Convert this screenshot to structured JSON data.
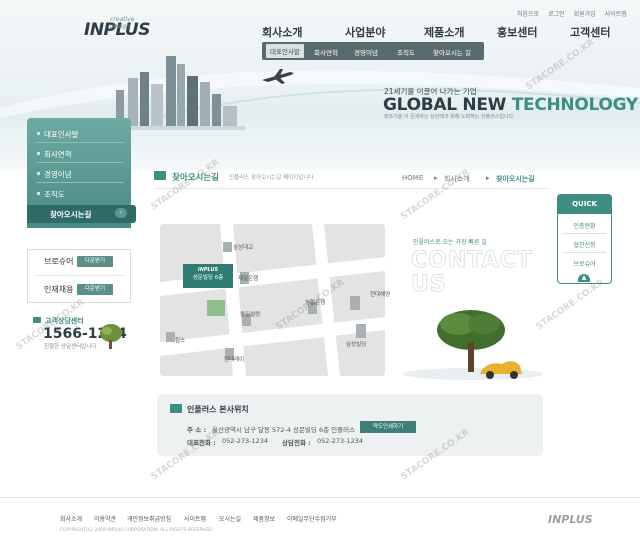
{
  "brand": {
    "logo": "INPLUS",
    "logo_tag": "creative design"
  },
  "util_links": [
    "처음으로",
    "로그인",
    "회원가입",
    "사이트맵"
  ],
  "gnb": [
    "회사소개",
    "사업분야",
    "제품소개",
    "홍보센터",
    "고객센터"
  ],
  "sub_nav": [
    "대표인사말",
    "회사연혁",
    "경영이념",
    "조직도",
    "찾아오시는 길"
  ],
  "slogan": {
    "ko": "21세기를 이끌어 나가는 기업",
    "en_a": "GLOBAL NEW ",
    "en_b": "TECHNOLOGY",
    "small": "창조기술 이 존재하는 상인테크 위해 노력하는 인플러스입니다."
  },
  "lnb": {
    "items": [
      "대표인사말",
      "회사연혁",
      "경영이념",
      "조직도"
    ],
    "active": "찾아오시는길"
  },
  "side_links": [
    {
      "label": "브로슈어",
      "button": "다운받기"
    },
    {
      "label": "인재채용",
      "button": "다운받기"
    }
  ],
  "customer_center": {
    "title": "고객상담센터",
    "phone": "1566-1234",
    "note": "친절한 상담센터입니다"
  },
  "content": {
    "title": "찾아오시는길",
    "desc": "인플러스 찾아오시는길 페이지입니다.",
    "breadcrumb": [
      "HOME",
      "회사소개",
      "찾아오시는길"
    ]
  },
  "map": {
    "marker_logo": "INPLUS",
    "marker_text": "성문빌딩 6층",
    "labels": [
      "제일은행",
      "동일설렁",
      "농협은행",
      "삼성빌딩",
      "현대해양",
      "킬스",
      "현대레이",
      "삼성대교"
    ]
  },
  "contact": {
    "ko": "인플러스로 오는 가장 빠른 길",
    "en_1": "CONTACT",
    "en_2": "US"
  },
  "quick": {
    "title": "QUICK",
    "items": [
      "인증현황",
      "협찬신청",
      "브로슈어"
    ]
  },
  "address": {
    "title": "인플러스 본사위치",
    "addr_label": "주 소 :",
    "addr_value": "울산광역시 남구 달동 572-4 성문빌딩 6층 인플러스",
    "map_button": "약도인쇄하기",
    "tel_label": "대표전화 :",
    "tel_value": "052-273-1234",
    "consult_label": "상담전화 :",
    "consult_value": "052-273-1234"
  },
  "footer": {
    "links": [
      "회사소개",
      "이용약관",
      "개인정보취급방침",
      "사이트맵",
      "오시는길",
      "제품정보",
      "이메일무단수집거부"
    ],
    "copy": "COPYRIGHT(C) 2009 INPLUS CORPORATION. ALL RIGHTS RESERVED.",
    "logo": "INPLUS"
  },
  "watermark": "STACORE.CO.KR"
}
